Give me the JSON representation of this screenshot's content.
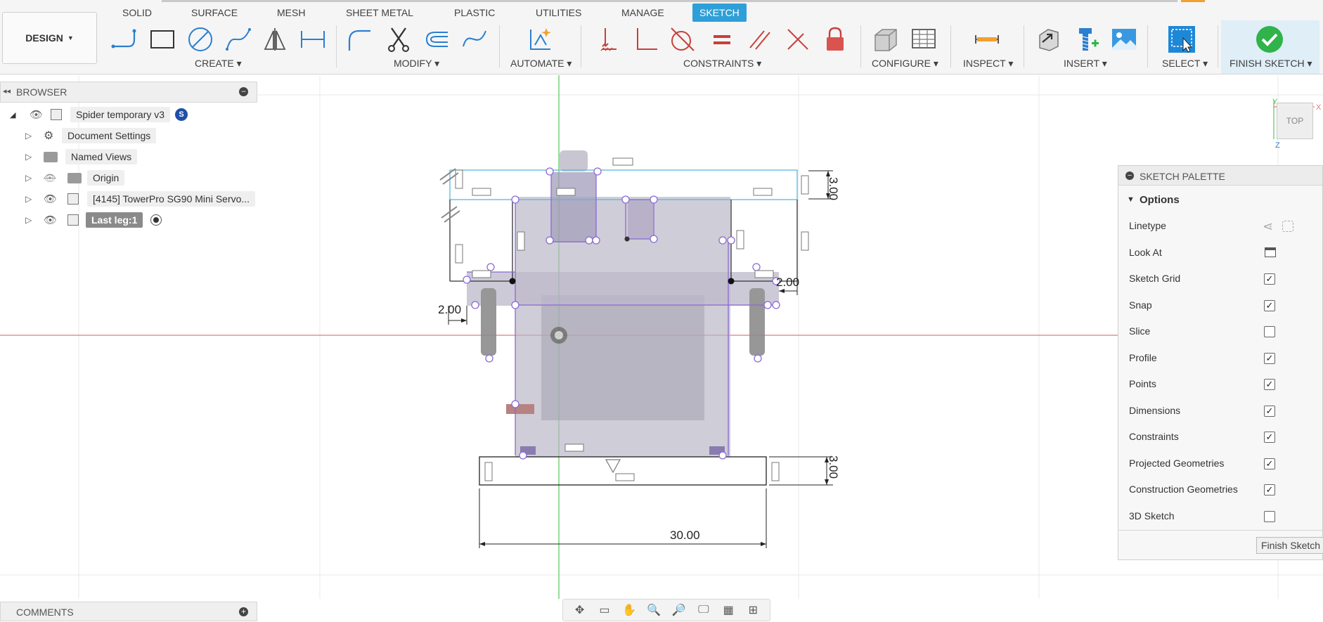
{
  "workspace": {
    "label": "DESIGN"
  },
  "tabs": [
    {
      "label": "SOLID"
    },
    {
      "label": "SURFACE"
    },
    {
      "label": "MESH"
    },
    {
      "label": "SHEET METAL"
    },
    {
      "label": "PLASTIC"
    },
    {
      "label": "UTILITIES"
    },
    {
      "label": "MANAGE"
    },
    {
      "label": "SKETCH"
    }
  ],
  "active_tab": "SKETCH",
  "groups": {
    "create": "CREATE ▾",
    "modify": "MODIFY ▾",
    "automate": "AUTOMATE ▾",
    "constraints": "CONSTRAINTS ▾",
    "configure": "CONFIGURE ▾",
    "inspect": "INSPECT ▾",
    "insert": "INSERT ▾",
    "select": "SELECT ▾",
    "finish": "FINISH SKETCH ▾"
  },
  "browser": {
    "title": "BROWSER",
    "items": [
      {
        "label": "Spider temporary v3",
        "badge": "S"
      },
      {
        "label": "Document Settings"
      },
      {
        "label": "Named Views"
      },
      {
        "label": "Origin"
      },
      {
        "label": "[4145] TowerPro SG90 Mini Servo..."
      },
      {
        "label": "Last leg:1"
      }
    ]
  },
  "viewcube": {
    "face": "TOP",
    "axis_x": "X",
    "axis_y": "Y",
    "axis_z": "Z"
  },
  "dimensions": {
    "top_height": "3.00",
    "right_offset": "2.00",
    "left_offset": "2.00",
    "bottom_height": "3.00",
    "bottom_width": "30.00"
  },
  "palette": {
    "title": "SKETCH PALETTE",
    "options_heading": "Options",
    "rows": [
      {
        "label": "Linetype",
        "kind": "linetype"
      },
      {
        "label": "Look At",
        "kind": "lookat"
      },
      {
        "label": "Sketch Grid",
        "checked": true
      },
      {
        "label": "Snap",
        "checked": true
      },
      {
        "label": "Slice",
        "checked": false
      },
      {
        "label": "Profile",
        "checked": true
      },
      {
        "label": "Points",
        "checked": true
      },
      {
        "label": "Dimensions",
        "checked": true
      },
      {
        "label": "Constraints",
        "checked": true
      },
      {
        "label": "Projected Geometries",
        "checked": true
      },
      {
        "label": "Construction Geometries",
        "checked": true
      },
      {
        "label": "3D Sketch",
        "checked": false
      }
    ],
    "finish_button": "Finish Sketch"
  },
  "comments": {
    "title": "COMMENTS"
  },
  "colors": {
    "accent": "#2f9fd8",
    "finish_green": "#2fb34a",
    "sketch_purple": "#8a6ad6",
    "axis_red": "#e06a6a",
    "axis_green": "#4bc24b",
    "constraint_red": "#c8403a"
  }
}
